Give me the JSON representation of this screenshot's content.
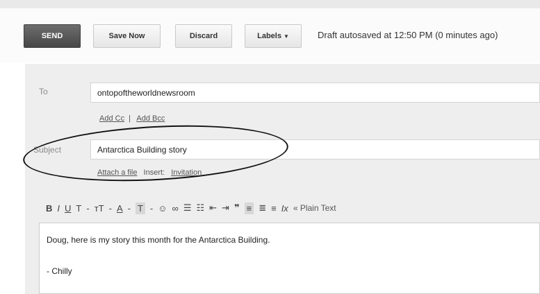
{
  "toolbar": {
    "send_label": "SEND",
    "save_label": "Save Now",
    "discard_label": "Discard",
    "labels_label": "Labels",
    "autosave_text": "Draft autosaved at 12:50 PM (0 minutes ago)"
  },
  "compose": {
    "to_label": "To",
    "to_value": "ontopoftheworldnewsroom",
    "add_cc": "Add Cc",
    "add_bcc": "Add Bcc",
    "subject_label": "Subject",
    "subject_value": "Antarctica Building story",
    "attach_file": "Attach a file",
    "insert_label": "Insert:",
    "insert_invitation": "Invitation"
  },
  "format_bar": {
    "bold": "B",
    "italic": "I",
    "underline": "U",
    "font": "T",
    "size": "тT",
    "text_color": "A",
    "highlight": "T",
    "emoji": "☺",
    "link": "∞",
    "numbered_list": "☰",
    "bullet_list": "☷",
    "indent_less": "⇤",
    "indent_more": "⇥",
    "quote": "❞",
    "align_left": "≡",
    "align_center": "≣",
    "align_right": "≡",
    "clear_format": "Ix",
    "plain_text": "« Plain Text",
    "dropdown_arrow": "-"
  },
  "message": {
    "line1": "Doug, here is my story this month for the Antarctica Building.",
    "line2": "- Chilly"
  }
}
